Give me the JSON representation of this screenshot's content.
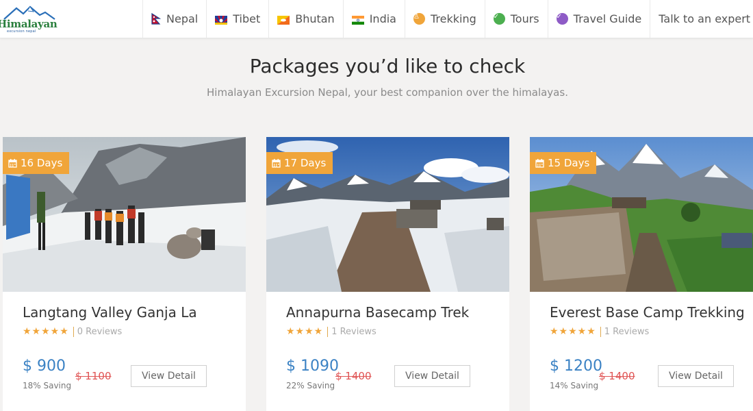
{
  "brand": {
    "name": "Himalayan",
    "tagline": "excursion nepal"
  },
  "nav": {
    "items": [
      {
        "label": "Nepal",
        "icon": "nepal-flag-icon"
      },
      {
        "label": "Tibet",
        "icon": "tibet-flag-icon"
      },
      {
        "label": "Bhutan",
        "icon": "bhutan-flag-icon"
      },
      {
        "label": "India",
        "icon": "india-flag-icon"
      },
      {
        "label": "Trekking",
        "icon": "trekking-icon"
      },
      {
        "label": "Tours",
        "icon": "tours-icon"
      },
      {
        "label": "Travel Guide",
        "icon": "travel-guide-icon"
      },
      {
        "label": "Talk to an expert",
        "icon": ""
      }
    ]
  },
  "section": {
    "title": "Packages you’d like to check",
    "subtitle": "Himalayan Excursion Nepal, your best companion over the himalayas."
  },
  "colors": {
    "accent": "#f0a53a",
    "price": "#3b82c4",
    "old_price": "#e05555"
  },
  "packages": [
    {
      "days": "16 Days",
      "title": "Langtang Valley Ganja La",
      "stars": "★★★★★",
      "rating": 5,
      "reviews": "0 Reviews",
      "price": "$ 900",
      "old_price": "$ 1100",
      "saving": "18% Saving",
      "button": "View Detail"
    },
    {
      "days": "17 Days",
      "title": "Annapurna Basecamp Trek",
      "stars": "★★★★",
      "rating": 4,
      "reviews": "1 Reviews",
      "price": "$ 1090",
      "old_price": "$ 1400",
      "saving": "22% Saving",
      "button": "View Detail"
    },
    {
      "days": "15 Days",
      "title": "Everest Base Camp Trekking",
      "stars": "★★★★★",
      "rating": 5,
      "reviews": "1 Reviews",
      "price": "$ 1200",
      "old_price": "$ 1400",
      "saving": "14% Saving",
      "button": "View Detail"
    }
  ]
}
